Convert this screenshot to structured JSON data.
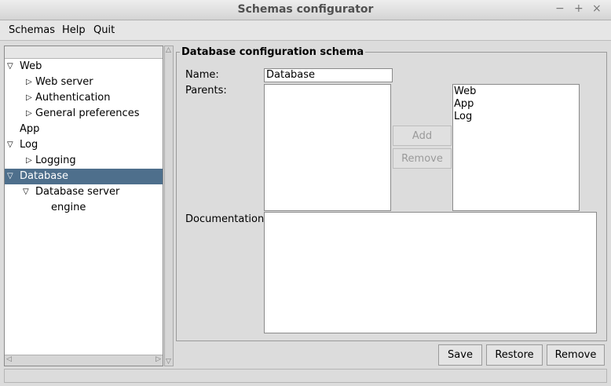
{
  "window": {
    "title": "Schemas configurator",
    "controls": {
      "minimize": "−",
      "maximize": "+",
      "close": "×"
    }
  },
  "menu": {
    "items": [
      "Schemas",
      "Help",
      "Quit"
    ]
  },
  "tree": {
    "expanded_glyph": "▽",
    "collapsed_glyph": "▷",
    "items": [
      {
        "label": "Web",
        "level": 0,
        "state": "expanded"
      },
      {
        "label": "Web server",
        "level": 1,
        "state": "collapsed"
      },
      {
        "label": "Authentication",
        "level": 1,
        "state": "collapsed"
      },
      {
        "label": "General preferences",
        "level": 1,
        "state": "collapsed"
      },
      {
        "label": "App",
        "level": 0,
        "state": "leaf"
      },
      {
        "label": "Log",
        "level": 0,
        "state": "expanded"
      },
      {
        "label": "Logging",
        "level": 1,
        "state": "collapsed"
      },
      {
        "label": "Database",
        "level": 0,
        "state": "expanded",
        "selected": true
      },
      {
        "label": "Database server",
        "level": 1,
        "state": "expanded"
      },
      {
        "label": "engine",
        "level": 2,
        "state": "leaf"
      }
    ]
  },
  "form": {
    "group_title": "Database configuration schema",
    "name_label": "Name:",
    "name_value": "Database",
    "parents_label": "Parents:",
    "documentation_label": "Documentation:",
    "selected_parents": [],
    "available_parents": [
      "Web",
      "App",
      "Log"
    ],
    "add_label": "Add",
    "remove_parent_label": "Remove"
  },
  "actions": {
    "save_label": "Save",
    "restore_label": "Restore",
    "remove_label": "Remove"
  },
  "colors": {
    "selection": "#4e6f8c"
  }
}
